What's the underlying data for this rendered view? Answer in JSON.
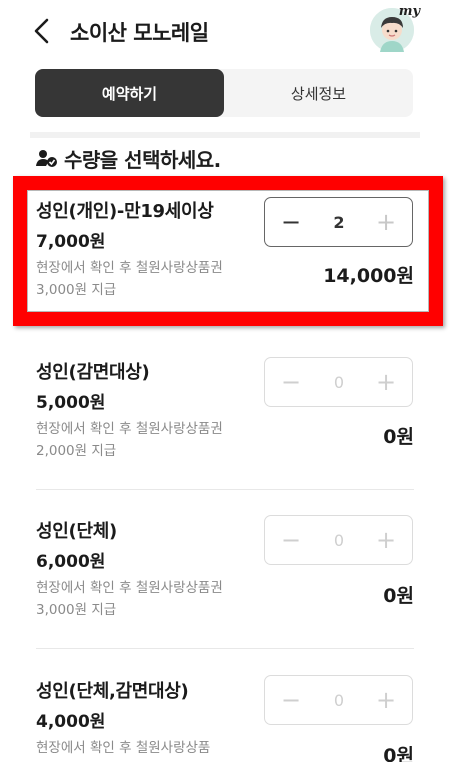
{
  "header": {
    "title": "소이산 모노레일",
    "avatar_text": "my"
  },
  "tabs": [
    {
      "label": "예약하기",
      "active": true
    },
    {
      "label": "상세정보",
      "active": false
    }
  ],
  "section": {
    "heading": "수량을 선택하세요.",
    "icon": "person-check-icon"
  },
  "items": [
    {
      "name": "성인(개인)-만19세이상",
      "price": "7,000원",
      "desc": "현장에서 확인 후 철원사랑상품권 3,000원 지급",
      "qty": "2",
      "total": "14,000원"
    },
    {
      "name": "성인(감면대상)",
      "price": "5,000원",
      "desc": "현장에서 확인 후 철원사랑상품권 2,000원 지급",
      "qty": "0",
      "total": "0원"
    },
    {
      "name": "성인(단체)",
      "price": "6,000원",
      "desc": "현장에서 확인 후 철원사랑상품권 3,000원 지급",
      "qty": "0",
      "total": "0원"
    },
    {
      "name": "성인(단체,감면대상)",
      "price": "4,000원",
      "desc": "현장에서 확인 후 철원사랑상품",
      "qty": "0",
      "total": "0원"
    }
  ],
  "stepper": {
    "minus": "−",
    "plus": "+"
  },
  "colors": {
    "highlight": "#ff0000",
    "tab_active_bg": "#363636",
    "avatar_bg": "#d9ece7"
  }
}
